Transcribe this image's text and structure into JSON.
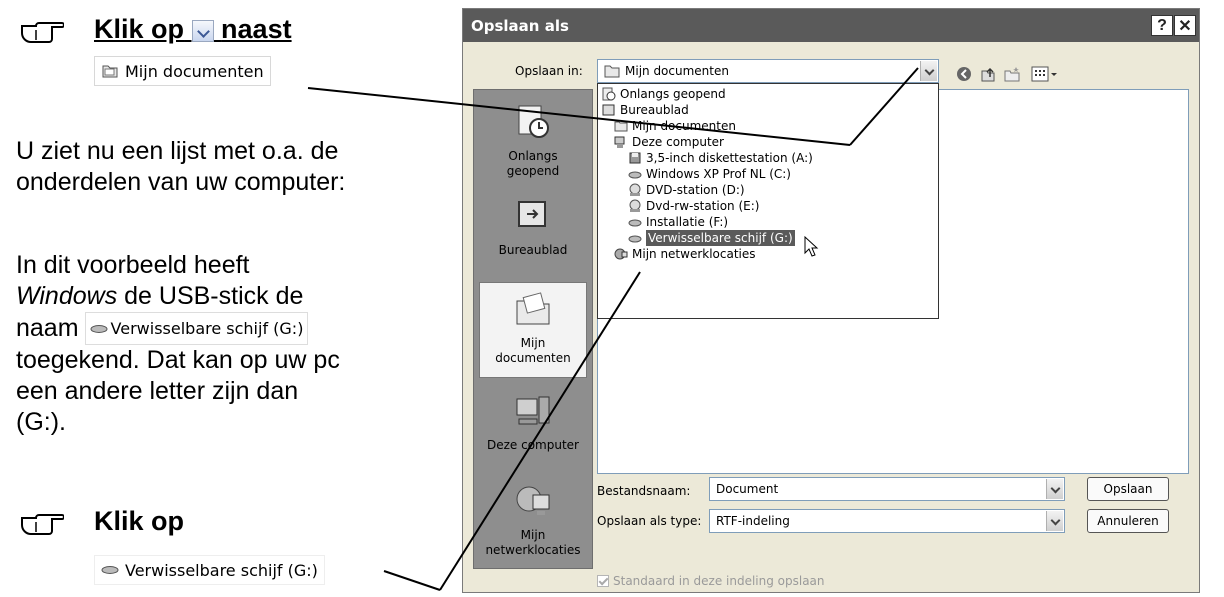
{
  "instructions": {
    "step1": {
      "prefix": "Klik op",
      "suffix": "naast",
      "chip_label": "Mijn documenten"
    },
    "para1": [
      "U ziet nu een lijst met o.a. de",
      "onderdelen van uw computer:"
    ],
    "para2": {
      "line1": "In dit voorbeeld heeft",
      "line2_italic": "Windows",
      "line2_rest": " de USB-stick de",
      "line3_prefix": "naam",
      "chip_label": "Verwisselbare schijf (G:)",
      "line4": "toegekend. Dat kan op uw pc",
      "line5": "een andere letter zijn dan",
      "line6": "(G:)."
    },
    "step2": {
      "title": "Klik op",
      "chip_label": "Verwisselbare schijf (G:)"
    }
  },
  "dialog": {
    "title": "Opslaan als",
    "help_button": "?",
    "close_button": "✕",
    "save_in_label": "Opslaan in:",
    "save_in_value": "Mijn documenten",
    "places": [
      {
        "label1": "Onlangs",
        "label2": "geopend",
        "icon": "recent-icon"
      },
      {
        "label1": "Bureaublad",
        "label2": "",
        "icon": "desktop-icon"
      },
      {
        "label1": "Mijn",
        "label2": "documenten",
        "icon": "my-documents-icon"
      },
      {
        "label1": "Deze computer",
        "label2": "",
        "icon": "computer-icon"
      },
      {
        "label1": "Mijn",
        "label2": "netwerklocaties",
        "icon": "network-icon"
      }
    ],
    "dropdown_items": [
      {
        "label": "Onlangs geopend",
        "icon": "recent-icon"
      },
      {
        "label": "Bureaublad",
        "icon": "desktop-icon"
      },
      {
        "label": "Mijn documenten",
        "icon": "folder-icon"
      },
      {
        "label": "Deze computer",
        "icon": "computer-icon"
      },
      {
        "label": "3,5-inch diskettestation (A:)",
        "icon": "floppy-icon"
      },
      {
        "label": "Windows XP Prof NL (C:)",
        "icon": "drive-icon"
      },
      {
        "label": "DVD-station (D:)",
        "icon": "dvd-icon"
      },
      {
        "label": "Dvd-rw-station (E:)",
        "icon": "dvd-icon"
      },
      {
        "label": "Installatie (F:)",
        "icon": "drive-icon"
      },
      {
        "label": "Verwisselbare schijf (G:)",
        "icon": "usb-drive-icon",
        "selected": true
      },
      {
        "label": "Mijn netwerklocaties",
        "icon": "network-icon"
      }
    ],
    "filename_label": "Bestandsnaam:",
    "filename_value": "Document",
    "filetype_label": "Opslaan als type:",
    "filetype_value": "RTF-indeling",
    "save_button": "Opslaan",
    "cancel_button": "Annuleren",
    "default_checkbox_label": "Standaard in deze indeling opslaan",
    "colors": {
      "titlebar": "#5a5a5a",
      "selection": "#5a5a5a",
      "places_bar": "#8e8e8e",
      "dialog_bg": "#ece9d8"
    }
  }
}
